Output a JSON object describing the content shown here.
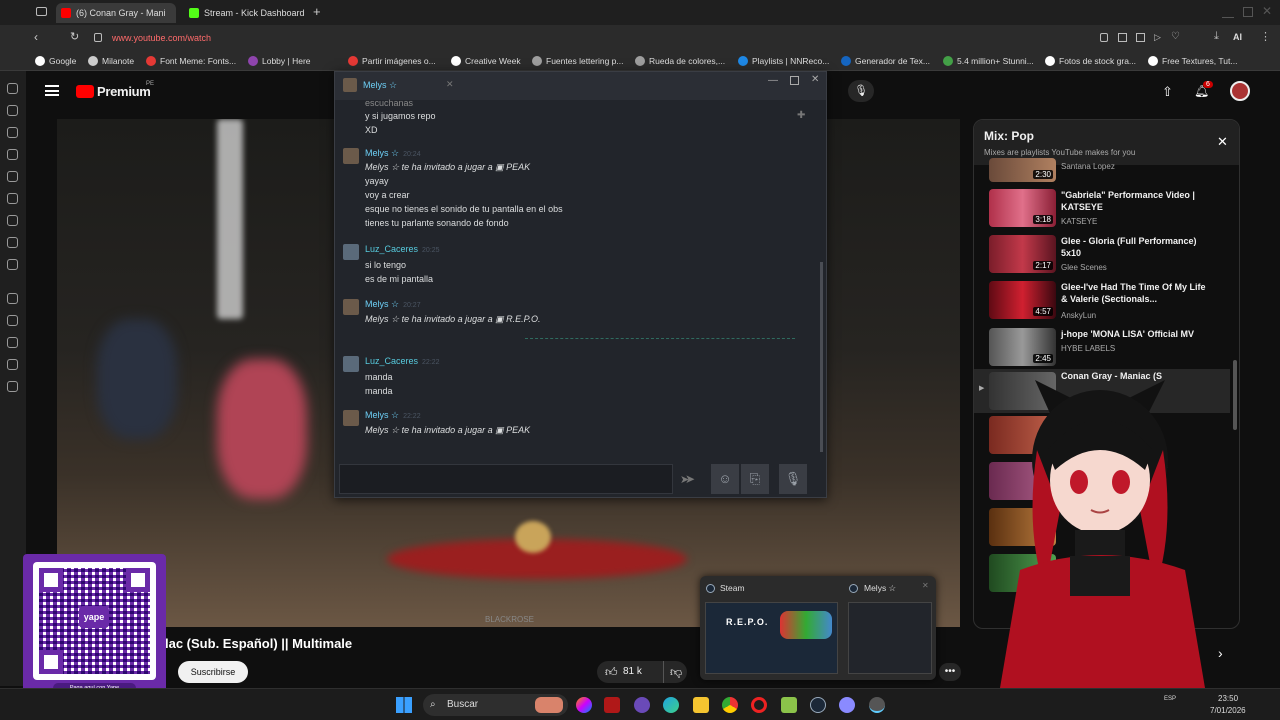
{
  "tabs": [
    {
      "label": "(6) Conan Gray - Mani",
      "icon": "youtube-icon",
      "color": "#ff0000",
      "active": true
    },
    {
      "label": "Stream - Kick Dashboard",
      "icon": "kick-icon",
      "color": "#53fc18",
      "active": false
    }
  ],
  "address": {
    "url": "www.youtube.com/watch"
  },
  "bookmarks": [
    {
      "label": "Google",
      "color": "#ffffff"
    },
    {
      "label": "Milanote",
      "color": "#cccccc"
    },
    {
      "label": "Font Meme: Fonts...",
      "color": "#e53935"
    },
    {
      "label": "Lobby | Here",
      "color": "#8e44ad"
    },
    {
      "label": "Partir imágenes o...",
      "color": "#e53935"
    },
    {
      "label": "Creative Week",
      "color": "#ffffff"
    },
    {
      "label": "Fuentes lettering p...",
      "color": "#9e9e9e"
    },
    {
      "label": "Rueda de colores,...",
      "color": "#9e9e9e"
    },
    {
      "label": "Playlists | NNReco...",
      "color": "#1e88e5"
    },
    {
      "label": "Generador de Tex...",
      "color": "#1565c0"
    },
    {
      "label": "5.4 million+ Stunni...",
      "color": "#43a047"
    },
    {
      "label": "Fotos de stock gra...",
      "color": "#ffffff"
    },
    {
      "label": "Free Textures, Tut...",
      "color": "#ffffff"
    }
  ],
  "youtube": {
    "logo": "Premium",
    "logo_suffix": "PE",
    "notifications": "6",
    "video_title_fragment": "lac (Sub. Español) || Multimale",
    "subscribe_label": "Suscribirse",
    "likes": "81 k",
    "watermark": "BLACKROSE"
  },
  "mix": {
    "title": "Mix: Pop",
    "subtitle": "Mixes are playlists YouTube makes for you",
    "items": [
      {
        "title": "",
        "channel": "Santana Lopez",
        "duration": "2:30"
      },
      {
        "title": "\"Gabriela\" Performance Video | KATSEYE",
        "channel": "KATSEYE",
        "duration": "3:18"
      },
      {
        "title": "Glee - Gloria (Full Performance) 5x10",
        "channel": "Glee Scenes",
        "duration": "2:17"
      },
      {
        "title": "Glee-I've Had The Time Of My Life & Valerie (Sectionals...",
        "channel": "AnskyLun",
        "duration": "4:57"
      },
      {
        "title": "j-hope 'MONA LISA' Official MV",
        "channel": "HYBE LABELS",
        "duration": "2:45"
      },
      {
        "title": "Conan Gray - Maniac (S",
        "channel": "",
        "duration": ""
      }
    ],
    "partial_text": "of"
  },
  "chat": {
    "title": "Melys ☆",
    "top_lines": [
      "escuchanas",
      "y si jugamos repo",
      "XD"
    ],
    "messages": [
      {
        "name": "Melys ☆",
        "time": "20:24",
        "color": "#6dcff6",
        "lines": [
          "Melys ☆ te ha invitado a jugar a ▣ PEAK",
          "yayay",
          "voy a crear",
          "esque no tienes el sonido de tu pantalla en el obs",
          "tienes tu parlante sonando de fondo"
        ]
      },
      {
        "name": "Luz_Caceres",
        "time": "20:25",
        "color": "#57cbde",
        "lines": [
          "si lo tengo",
          "es de mi pantalla"
        ]
      },
      {
        "name": "Melys ☆",
        "time": "20:27",
        "color": "#6dcff6",
        "lines": [
          "Melys ☆ te ha invitado a jugar a ▣ R.E.P.O."
        ]
      },
      {
        "name": "Luz_Caceres",
        "time": "22:22",
        "color": "#57cbde",
        "lines": [
          "manda",
          "manda"
        ]
      },
      {
        "name": "Melys ☆",
        "time": "22:22",
        "color": "#6dcff6",
        "lines": [
          "Melys ☆ te ha invitado a jugar a ▣ PEAK"
        ]
      }
    ]
  },
  "qr": {
    "brand": "yape",
    "caption": "Paga aquí con Yape"
  },
  "taskbar": {
    "search_label": "Buscar",
    "preview_steam": "Steam",
    "preview_chat": "Melys ☆",
    "preview_game": "R.E.P.O.",
    "clock_time": "23:50",
    "clock_date": "7/01/2026",
    "lang": "ESP"
  }
}
